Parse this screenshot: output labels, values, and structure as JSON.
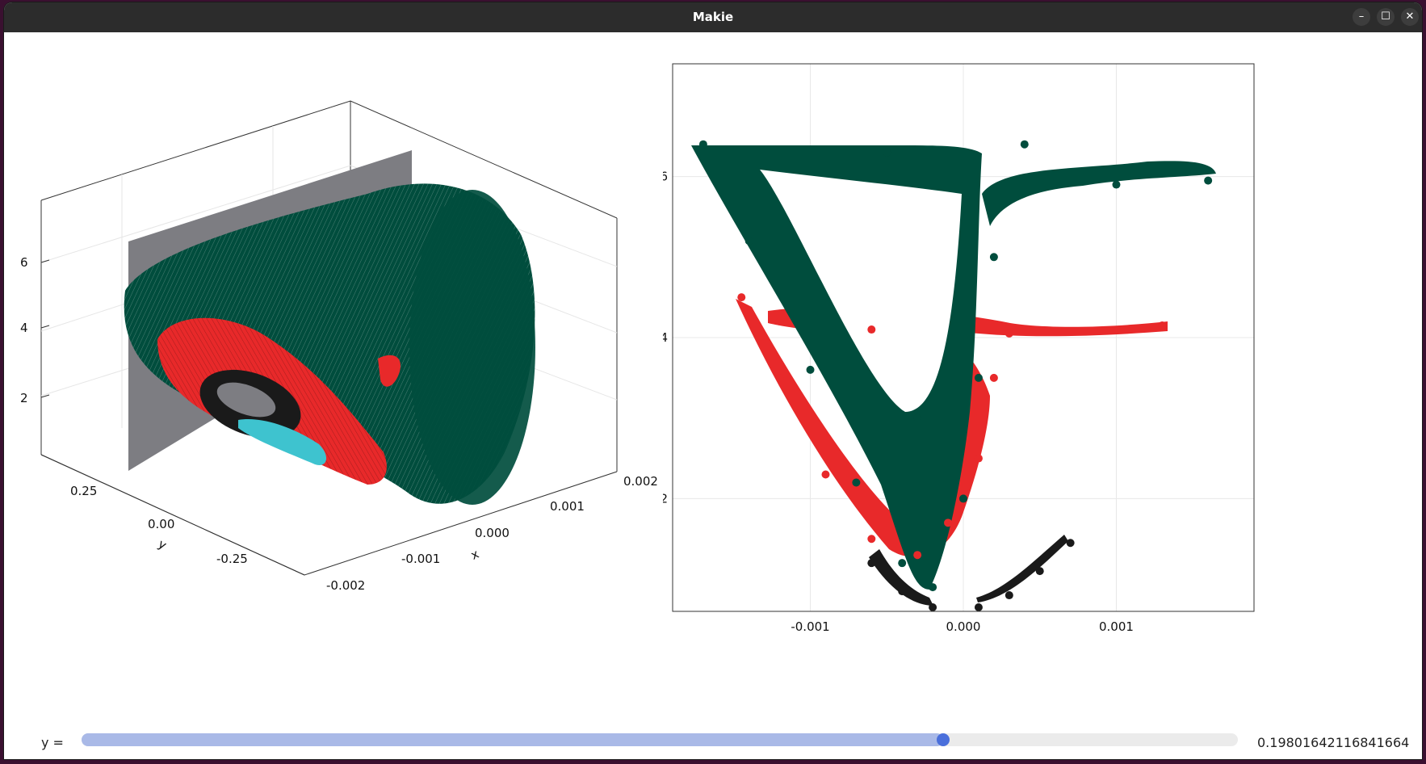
{
  "window": {
    "title": "Makie",
    "controls": {
      "minimize": "–",
      "maximize": "☐",
      "close": "✕"
    }
  },
  "colors": {
    "green": "#004d3d",
    "red": "#e8292a",
    "black": "#1a1a1a",
    "cyan": "#3ec3cf",
    "plane": "#7d7d82",
    "slider_fill": "#a9b9e7",
    "slider_knob": "#4a6fdb"
  },
  "plot3d": {
    "type": "3d-scatter",
    "zticks": [
      "2",
      "4",
      "6"
    ],
    "yticks": [
      "0.25",
      "0.00",
      "-0.25"
    ],
    "xticks": [
      "-0.002",
      "-0.001",
      "0.000",
      "0.001",
      "0.002"
    ],
    "ylabel": "y",
    "xlabel": "x",
    "series_colors": [
      "green",
      "red",
      "black",
      "cyan"
    ]
  },
  "chart_data": {
    "type": "scatter",
    "xlim": [
      -0.0019,
      0.0019
    ],
    "ylim": [
      0.6,
      7.4
    ],
    "xticks": [
      "-0.001",
      "0.000",
      "0.001"
    ],
    "yticks": [
      "2",
      "4",
      "6"
    ],
    "grid": true,
    "series": [
      {
        "color": "red",
        "points": [
          [
            -0.00145,
            4.5
          ],
          [
            -0.0012,
            3.5
          ],
          [
            -0.0009,
            2.3
          ],
          [
            -0.0006,
            1.5
          ],
          [
            -0.0003,
            1.3
          ],
          [
            -0.0001,
            1.7
          ],
          [
            0.0001,
            2.5
          ],
          [
            0.0002,
            3.5
          ],
          [
            -0.0012,
            4.2
          ],
          [
            -0.0006,
            4.1
          ],
          [
            0.0003,
            4.05
          ],
          [
            0.0013,
            4.15
          ]
        ]
      },
      {
        "color": "green",
        "points": [
          [
            -0.0017,
            6.4
          ],
          [
            -0.0014,
            5.2
          ],
          [
            -0.001,
            3.6
          ],
          [
            -0.0007,
            2.2
          ],
          [
            -0.0004,
            1.2
          ],
          [
            -0.0002,
            0.9
          ],
          [
            0.0,
            2.0
          ],
          [
            0.0001,
            3.5
          ],
          [
            0.0002,
            5.0
          ],
          [
            0.0004,
            6.4
          ],
          [
            -0.0005,
            6.3
          ],
          [
            0.001,
            5.9
          ],
          [
            0.0016,
            5.95
          ],
          [
            -0.0003,
            3.0
          ]
        ]
      },
      {
        "color": "black",
        "points": [
          [
            -0.0006,
            1.2
          ],
          [
            -0.0004,
            0.85
          ],
          [
            -0.0002,
            0.65
          ],
          [
            0.0001,
            0.65
          ],
          [
            0.0003,
            0.8
          ],
          [
            0.0005,
            1.1
          ],
          [
            0.0007,
            1.45
          ]
        ]
      }
    ]
  },
  "slider": {
    "label": "y =",
    "value_text": "0.19801642116841664",
    "fraction": 0.745
  }
}
